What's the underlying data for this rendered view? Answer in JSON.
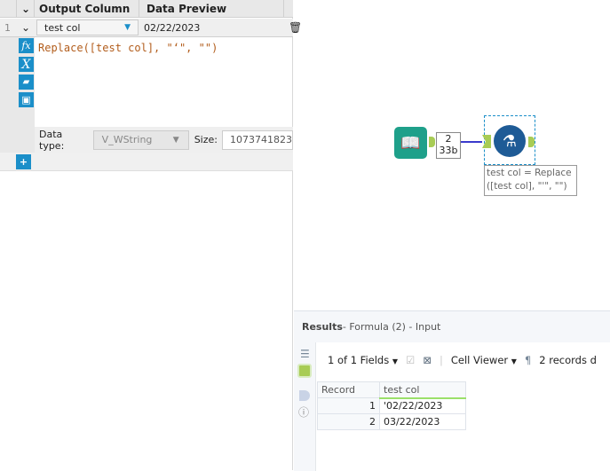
{
  "formula_panel": {
    "headers": {
      "output_column": "Output Column",
      "data_preview": "Data Preview"
    },
    "row": {
      "index": "1",
      "column": "test col",
      "preview": "02/22/2023"
    },
    "expression": "Replace([test col], \"‘\", \"\")",
    "data_type_label": "Data type:",
    "data_type": "V_WString",
    "size_label": "Size:",
    "size": "1073741823",
    "icons": [
      "fx-icon",
      "variable-icon",
      "open-folder-icon",
      "save-icon",
      "add-icon"
    ]
  },
  "canvas": {
    "connection_count": "2",
    "connection_size": "33b",
    "annotation": "test col = Replace ([test col], \"'\", \"\")"
  },
  "results": {
    "title": "Results",
    "subtitle": " - Formula (2) - Input",
    "fields": "1 of 1 Fields",
    "viewer": "Cell Viewer",
    "records": "2 records d",
    "columns": [
      "Record",
      "test col"
    ],
    "rows": [
      {
        "record": "1",
        "value": "'02/22/2023"
      },
      {
        "record": "2",
        "value": "03/22/2023"
      }
    ]
  },
  "colors": {
    "accent": "#1b8fc9",
    "connector": "#a8cc55",
    "formula_tool": "#1e5b96",
    "input_tool": "#1ea08a"
  }
}
